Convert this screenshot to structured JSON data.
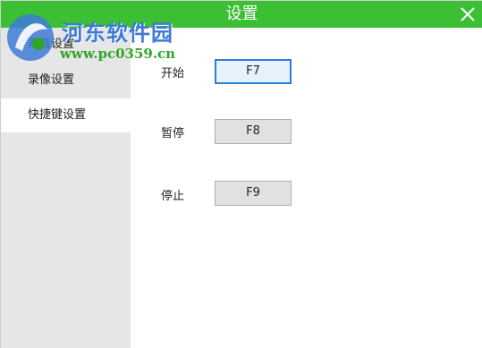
{
  "window": {
    "title": "设置",
    "close_icon": "close-icon"
  },
  "watermark": {
    "name": "河东软件园",
    "url": "www.pc0359.cn"
  },
  "sidebar": {
    "items": [
      {
        "label": "声音设置",
        "active": false
      },
      {
        "label": "录像设置",
        "active": false
      },
      {
        "label": "快捷键设置",
        "active": true
      }
    ]
  },
  "hotkeys": [
    {
      "label": "开始",
      "key": "F7"
    },
    {
      "label": "暂停",
      "key": "F8"
    },
    {
      "label": "停止",
      "key": "F9"
    }
  ],
  "colors": {
    "accent": "#3dbf35",
    "sidebar_bg": "#e6e6e6",
    "watermark_blue": "#3d7bd6",
    "watermark_green": "#2fa52a"
  }
}
